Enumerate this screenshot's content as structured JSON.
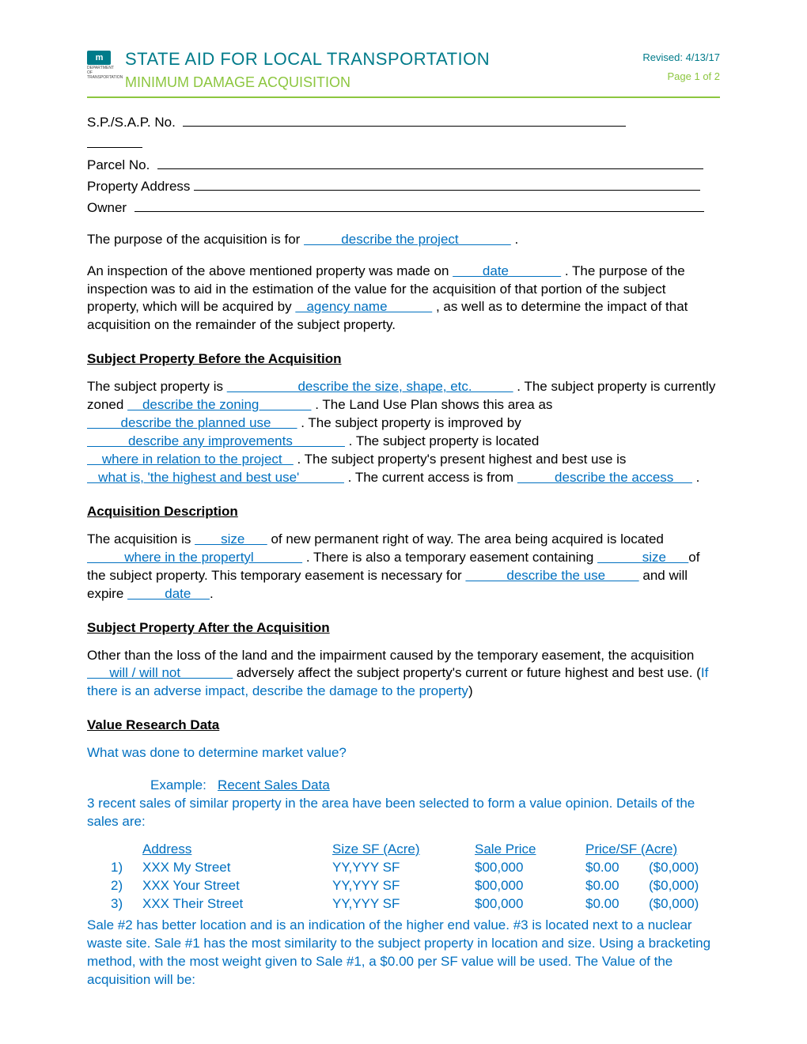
{
  "header": {
    "logo_text": "m",
    "logo_sub": "DEPARTMENT OF TRANSPORTATION",
    "title": "STATE AID FOR LOCAL TRANSPORTATION",
    "subtitle": "MINIMUM DAMAGE ACQUISITION",
    "revised": "Revised: 4/13/17",
    "page": "Page 1 of 2"
  },
  "fields": {
    "sp_label": "S.P./S.A.P. No.",
    "parcel_label": "Parcel No.",
    "address_label": "Property Address",
    "owner_label": "Owner"
  },
  "purpose": {
    "pre": "The purpose of the acquisition is for ",
    "fill": "          describe the project              ",
    "post": " ."
  },
  "inspection": {
    "p1a": "An inspection of the above mentioned property was made on ",
    "date": "        date              ",
    "p1b": " .  The purpose of the inspection was to aid in the estimation of the value for the acquisition of that portion of the subject property, which will be acquired by ",
    "agency": "   agency name            ",
    "p1c": " , as well as to determine the impact of that acquisition on the remainder of the subject property."
  },
  "before": {
    "head": "Subject Property Before the Acquisition",
    "t1": "The subject property is ",
    "f1": "                   describe the size, shape, etc.           ",
    "t2": " .  The subject property is currently zoned ",
    "f2": "    describe the zoning              ",
    "t3": " .  The Land Use Plan shows this area as ",
    "f3": "         describe the planned use       ",
    "t4": " .  The subject property is improved by ",
    "f4": "           describe any improvements              ",
    "t5": " .  The subject property is located ",
    "f5": "    where in relation to the project   ",
    "t6": " .  The subject property's present highest and best use is ",
    "f6": "   what is, 'the highest and best use'            ",
    "t7": " .  The current access is from ",
    "f7": "          describe the access     ",
    "t8": " ."
  },
  "acq": {
    "head": "Acquisition Description ",
    "t1": "The acquisition is ",
    "f1": "       size      ",
    "t2": " of new permanent right of way.  The area being acquired is located ",
    "f2": "          where in the propertyl             ",
    "t3": " .  There is also a temporary easement containing ",
    "f3": "            size      ",
    "t4": "of the subject property.  This temporary easement is necessary for ",
    "f4": "           describe the use         ",
    "t5": " and will expire ",
    "f5": "          date     ",
    "t6": "."
  },
  "after": {
    "head": "Subject Property After the Acquisition",
    "t1": "Other than the loss of the land and the impairment caused by the temporary easement, the acquisition ",
    "f1": "      will / will not              ",
    "t2": " adversely affect the subject property's current or future highest and best use.  (",
    "note": "If there is an adverse impact, describe the damage to the property",
    "t3": ")"
  },
  "value": {
    "head": "Value Research Data",
    "q": "What was done to determine market value?",
    "ex_label": "Example:",
    "ex_title": "Recent Sales Data",
    "intro": "3 recent sales of similar property in the area have been selected to form a value opinion.  Details of the sales are:",
    "hdr": {
      "addr": "Address",
      "size": "Size  SF  (Acre)",
      "price": "Sale Price",
      "psf": "Price/SF (Acre)"
    },
    "rows": [
      {
        "n": "1)",
        "addr": "XXX  My Street",
        "size": "YY,YYY  SF",
        "price": "$00,000",
        "psf": "$0.00",
        "acre": "($0,000)"
      },
      {
        "n": "2)",
        "addr": "XXX  Your Street",
        "size": "YY,YYY  SF",
        "price": "$00,000",
        "psf": "$0.00",
        "acre": "($0,000)"
      },
      {
        "n": "3)",
        "addr": "XXX  Their Street",
        "size": "YY,YYY  SF",
        "price": "$00,000",
        "psf": "$0.00",
        "acre": "($0,000)"
      }
    ],
    "analysis": "Sale #2 has better location and is an indication of the higher end value.  #3 is located next to a nuclear waste site.  Sale #1 has the most similarity to the subject property in location and size.  Using a bracketing method, with the most weight given to Sale #1, a $0.00 per SF value will be used.  The Value of the acquisition will be:"
  }
}
